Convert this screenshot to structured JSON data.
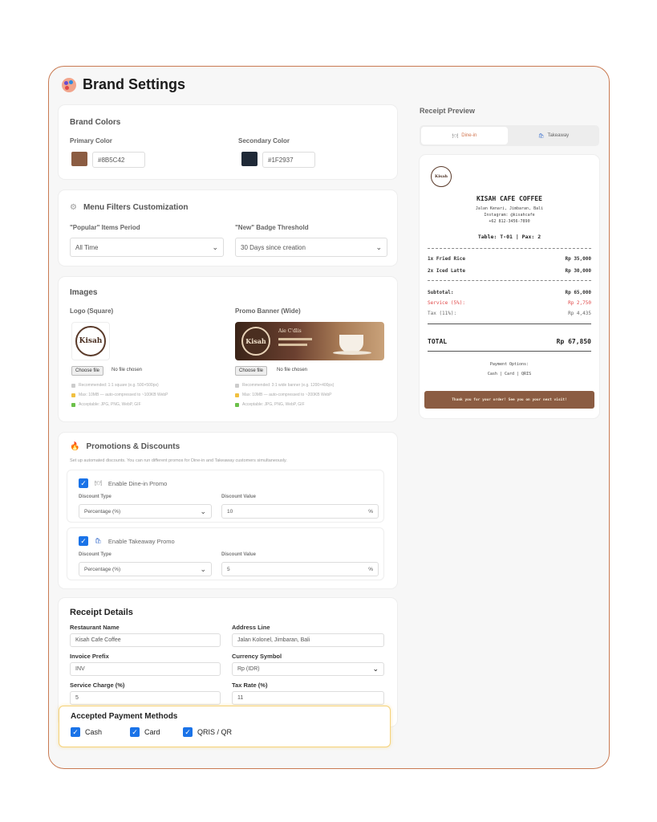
{
  "header": {
    "title": "Brand Settings"
  },
  "brand_colors": {
    "heading": "Brand Colors",
    "primary_label": "Primary Color",
    "primary_value": "#8B5C42",
    "secondary_label": "Secondary Color",
    "secondary_value": "#1F2937"
  },
  "menu_filters": {
    "heading": "Menu Filters Customization",
    "popular_label": "\"Popular\" Items Period",
    "popular_value": "All Time",
    "new_label": "\"New\" Badge Threshold",
    "new_value": "30 Days since creation"
  },
  "images": {
    "heading": "Images",
    "logo_label": "Logo (Square)",
    "banner_label": "Promo Banner (Wide)",
    "logo_text": "Kisah",
    "banner_logo_text": "Kisah",
    "banner_title": "Aie C'dlis",
    "choose_file": "Choose file",
    "no_file": "No file chosen",
    "logo_notes": [
      "Recommended: 1:1 square (e.g. 500×500px)",
      "Max: 10MB — auto-compressed to ~100KB WebP",
      "Acceptable: JPG, PNG, WebP, GIF"
    ],
    "banner_notes": [
      "Recommended: 3:1 wide banner (e.g. 1200×400px)",
      "Max: 10MB — auto-compressed to ~200KB WebP",
      "Acceptable: JPG, PNG, WebP, GIF"
    ]
  },
  "promotions": {
    "heading": "Promotions & Discounts",
    "subtitle": "Set up automated discounts. You can run different promos for Dine-in and Takeaway customers simultaneously.",
    "dine_in": {
      "label": "Enable Dine-in Promo",
      "type_label": "Discount Type",
      "type_value": "Percentage (%)",
      "value_label": "Discount Value",
      "value": "10",
      "unit": "%"
    },
    "takeaway": {
      "label": "Enable Takeaway Promo",
      "type_label": "Discount Type",
      "type_value": "Percentage (%)",
      "value_label": "Discount Value",
      "value": "5",
      "unit": "%"
    }
  },
  "receipt_details": {
    "heading": "Receipt Details",
    "restaurant_name_label": "Restaurant Name",
    "restaurant_name": "Kisah Cafe Coffee",
    "address_label": "Address Line",
    "address": "Jalan Kolonel, Jimbaran, Bali",
    "invoice_prefix_label": "Invoice Prefix",
    "invoice_prefix": "INV",
    "currency_label": "Currency Symbol",
    "currency": "Rp (IDR)",
    "service_label": "Service Charge (%)",
    "service": "5",
    "tax_label": "Tax Rate (%)",
    "tax": "11"
  },
  "payment_methods": {
    "heading": "Accepted Payment Methods",
    "options": [
      "Cash",
      "Card",
      "QRIS / QR"
    ]
  },
  "preview": {
    "heading": "Receipt Preview",
    "tab_dine_in": "Dine-in",
    "tab_takeaway": "Takeaway",
    "logo_text": "Kisah",
    "shop_name": "KISAH CAFE COFFEE",
    "address": "Jalan Kenari, Jimbaran, Bali",
    "instagram": "Instagram: @kisahcafe",
    "phone": "+62 812-3456-7890",
    "table_line": "Table: T-01 | Pax: 2",
    "items": [
      {
        "name": "1x Fried Rice",
        "price": "Rp 35,000"
      },
      {
        "name": "2x Iced Latte",
        "price": "Rp 30,000"
      }
    ],
    "subtotal_label": "Subtotal:",
    "subtotal": "Rp 65,000",
    "service_label": "Service (5%):",
    "service": "Rp 2,750",
    "tax_label": "Tax (11%):",
    "tax": "Rp 4,435",
    "total_label": "TOTAL",
    "total": "Rp 67,850",
    "payment_options_label": "Payment Options:",
    "payment_options": "Cash | Card | QRIS",
    "footer": "Thank you for your order! See you on your next visit!"
  },
  "colors": {
    "brand": "#8B5C42",
    "dark": "#1F2937",
    "accent": "#1a73e8",
    "highlight": "#f5d27a",
    "frame": "#c97a52"
  }
}
